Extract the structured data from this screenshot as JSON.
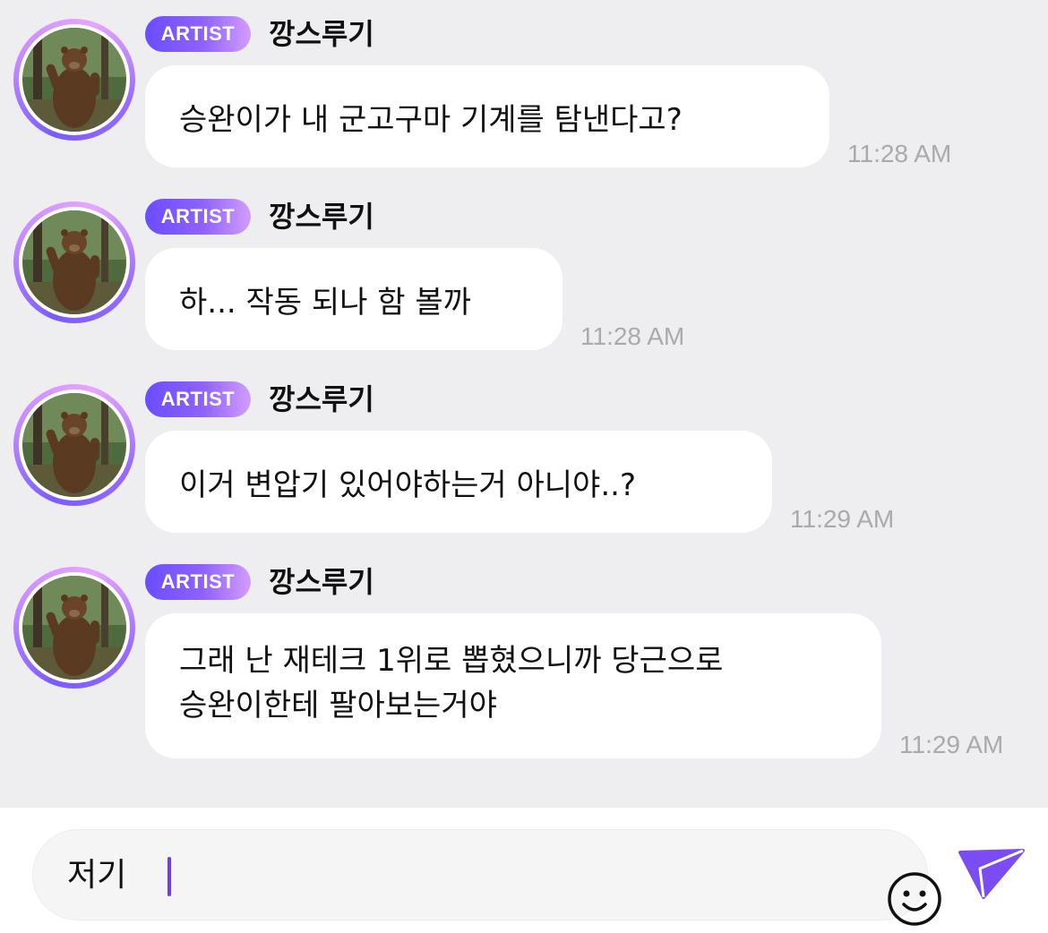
{
  "messages": [
    {
      "badge": "ARTIST",
      "sender": "깡스루기",
      "text": "승완이가 내 군고구마 기계를 탐낸다고?",
      "time": "11:28 AM"
    },
    {
      "badge": "ARTIST",
      "sender": "깡스루기",
      "text": "하... 작동 되나 함 볼까",
      "time": "11:28 AM"
    },
    {
      "badge": "ARTIST",
      "sender": "깡스루기",
      "text": "이거 변압기 있어야하는거 아니야..?",
      "time": "11:29 AM"
    },
    {
      "badge": "ARTIST",
      "sender": "깡스루기",
      "lines": [
        "그래 난 재테크 1위로 뽑혔으니까 당근으로",
        "승완이한테 팔아보는거야"
      ],
      "time": "11:29 AM"
    }
  ],
  "composer": {
    "text": "저기"
  },
  "icons": {
    "avatar": "bear-avatar-icon",
    "emoji": "smiley-icon",
    "send": "send-icon"
  },
  "colors": {
    "accent": "#7b4cf2",
    "badge_start": "#6a4dff",
    "badge_end": "#d39cff",
    "chat_bg": "#eeeef0",
    "bubble": "#ffffff",
    "time": "#a9a9ae"
  }
}
